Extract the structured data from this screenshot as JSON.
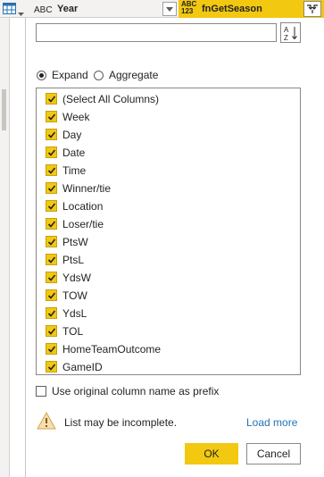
{
  "header": {
    "icons": {
      "table": "table-icon",
      "type": "abc-type-icon",
      "expand": "expand-columns-icon"
    },
    "abc_text": "ABC",
    "year_column": "Year",
    "active_type_line1": "ABC",
    "active_type_line2": "123",
    "active_column": "fnGetSeason",
    "accent_color": "#f2c811"
  },
  "panel": {
    "search": {
      "value": "",
      "placeholder": ""
    },
    "sort_icon": "sort-az-icon",
    "radio": {
      "expand_label": "Expand",
      "aggregate_label": "Aggregate",
      "selected": "Expand"
    },
    "columns": [
      {
        "label": "(Select All Columns)",
        "checked": true
      },
      {
        "label": "Week",
        "checked": true
      },
      {
        "label": "Day",
        "checked": true
      },
      {
        "label": "Date",
        "checked": true
      },
      {
        "label": "Time",
        "checked": true
      },
      {
        "label": "Winner/tie",
        "checked": true
      },
      {
        "label": "Location",
        "checked": true
      },
      {
        "label": "Loser/tie",
        "checked": true
      },
      {
        "label": "PtsW",
        "checked": true
      },
      {
        "label": "PtsL",
        "checked": true
      },
      {
        "label": "YdsW",
        "checked": true
      },
      {
        "label": "TOW",
        "checked": true
      },
      {
        "label": "YdsL",
        "checked": true
      },
      {
        "label": "TOL",
        "checked": true
      },
      {
        "label": "HomeTeamOutcome",
        "checked": true
      },
      {
        "label": "GameID",
        "checked": true
      }
    ],
    "prefix_label": "Use original column name as prefix",
    "prefix_checked": false,
    "warning_icon": "warning-icon",
    "warning_text": "List may be incomplete.",
    "load_more_label": "Load more",
    "ok_label": "OK",
    "cancel_label": "Cancel"
  }
}
